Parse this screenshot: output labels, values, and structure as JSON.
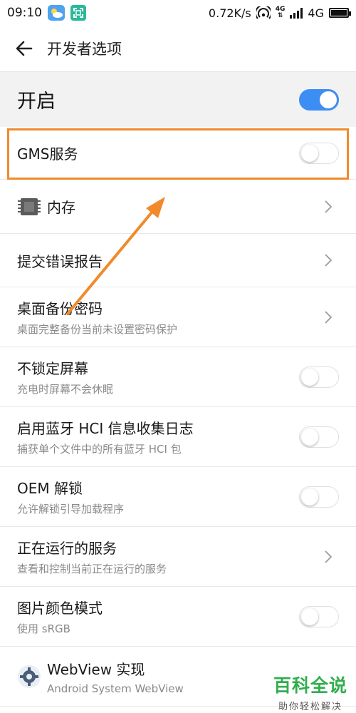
{
  "status_bar": {
    "time": "09:10",
    "speed": "0.72K/s",
    "net_gen_top": "4G",
    "net_gen_bottom": "⇅",
    "network": "4G"
  },
  "app_bar": {
    "title": "开发者选项"
  },
  "master": {
    "label": "开启",
    "on": true
  },
  "items": [
    {
      "title": "GMS服务",
      "subtitle": "",
      "control": "toggle",
      "on": false
    },
    {
      "title": "内存",
      "subtitle": "",
      "control": "chevron",
      "icon": "memory-chip-icon"
    },
    {
      "title": "提交错误报告",
      "subtitle": "",
      "control": "chevron"
    },
    {
      "title": "桌面备份密码",
      "subtitle": "桌面完整备份当前未设置密码保护",
      "control": "chevron"
    },
    {
      "title": "不锁定屏幕",
      "subtitle": "充电时屏幕不会休眠",
      "control": "toggle",
      "on": false
    },
    {
      "title": "启用蓝牙 HCI 信息收集日志",
      "subtitle": "捕获单个文件中的所有蓝牙 HCI 包",
      "control": "toggle",
      "on": false
    },
    {
      "title": "OEM 解锁",
      "subtitle": "允许解锁引导加载程序",
      "control": "toggle",
      "on": false
    },
    {
      "title": "正在运行的服务",
      "subtitle": "查看和控制当前正在运行的服务",
      "control": "chevron"
    },
    {
      "title": "图片颜色模式",
      "subtitle": "使用 sRGB",
      "control": "toggle",
      "on": false
    },
    {
      "title": "WebView 实现",
      "subtitle": "Android System WebView",
      "control": "none",
      "icon": "webview-gear-icon"
    }
  ],
  "annotation": {
    "highlight_color": "#f08a2b",
    "arrow_color": "#f08a2b"
  },
  "watermark": {
    "main": "百科全说",
    "sub": "助你轻松解决"
  },
  "colors": {
    "toggle_on": "#3c8ef4",
    "master_bg": "#f2f2f2",
    "watermark_green": "#2fae4d"
  }
}
